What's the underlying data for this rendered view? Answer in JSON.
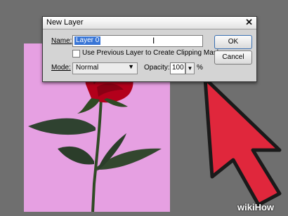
{
  "dialog": {
    "title": "New Layer",
    "close_glyph": "✕",
    "name_label": "Name:",
    "name_value": "Layer 0",
    "clipping_label": "Use Previous Layer to Create Clipping Mask",
    "mode_label": "Mode:",
    "mode_value": "Normal",
    "opacity_label": "Opacity:",
    "opacity_value": "100",
    "percent": "%",
    "ok_label": "OK",
    "cancel_label": "Cancel",
    "clipping_checked": false
  },
  "watermark": {
    "text": "wikiHow"
  },
  "colors": {
    "arrow": "#e0273c",
    "doc_bg": "#e6a0e2",
    "rose": "#b3001b",
    "selection": "#3875d6"
  },
  "icons": {
    "text_cursor": "text-cursor-icon",
    "dropdown": "chevron-down-icon"
  }
}
